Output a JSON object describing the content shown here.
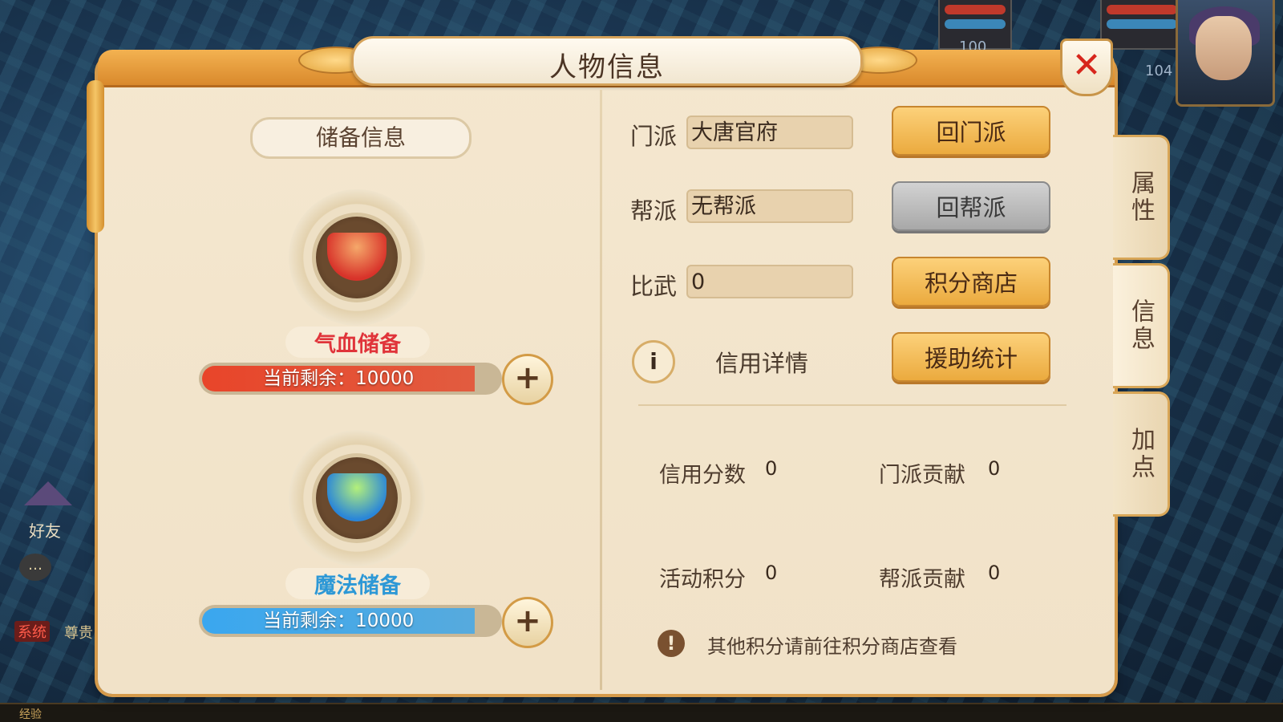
{
  "window": {
    "title": "人物信息"
  },
  "hud": {
    "level_left": "100",
    "level_right": "104"
  },
  "left_ui": {
    "friend_label": "好友",
    "system_tag": "系统",
    "system_text": "尊贵",
    "exp_label": "经验"
  },
  "reserve": {
    "section_title": "储备信息",
    "hp": {
      "label": "气血储备",
      "remaining_text": "当前剩余：10000",
      "fill": 0.92,
      "color": "#e8452a"
    },
    "mp": {
      "label": "魔法储备",
      "remaining_text": "当前剩余：10000",
      "fill": 0.92,
      "color": "#3aa7ef"
    },
    "plus_symbol": "+"
  },
  "info": {
    "sect_label": "门派",
    "sect_value": "大唐官府",
    "sect_button": "回门派",
    "guild_label": "帮派",
    "guild_value": "无帮派",
    "guild_button": "回帮派",
    "pk_label": "比武",
    "pk_value": "0",
    "shop_button": "积分商店",
    "credit_icon": "i",
    "credit_label": "信用详情",
    "assist_button": "援助统计"
  },
  "stats": {
    "credit_score_label": "信用分数",
    "credit_score_value": "0",
    "sect_contrib_label": "门派贡献",
    "sect_contrib_value": "0",
    "activity_label": "活动积分",
    "activity_value": "0",
    "guild_contrib_label": "帮派贡献",
    "guild_contrib_value": "0"
  },
  "note": {
    "icon": "!",
    "text": "其他积分请前往积分商店查看"
  },
  "tabs": [
    {
      "label": "属性",
      "active": false
    },
    {
      "label": "信息",
      "active": true
    },
    {
      "label": "加点",
      "active": false
    }
  ],
  "close_symbol": "✕",
  "icons": [
    "close-icon",
    "plus-icon",
    "info-icon",
    "warning-icon",
    "hp-potion-icon",
    "mp-potion-icon",
    "chat-icon"
  ]
}
